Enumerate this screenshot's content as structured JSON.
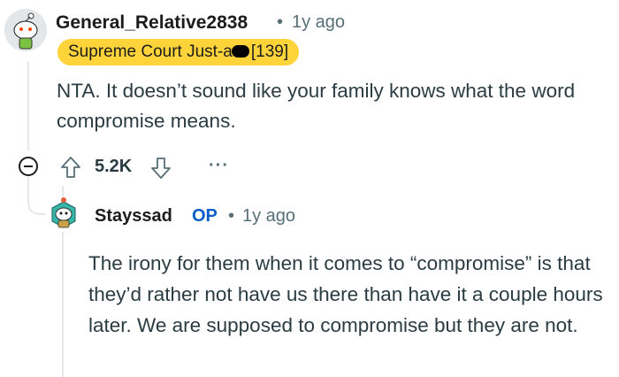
{
  "comment": {
    "username": "General_Relative2838",
    "time": "1y ago",
    "flair_prefix": "Supreme Court Just-a",
    "flair_suffix": "[139]",
    "body": "NTA. It doesn’t sound like your family knows what the word compromise means.",
    "score": "5.2K",
    "more": "···"
  },
  "reply": {
    "username": "Stayssad",
    "op_badge": "OP",
    "time": "1y ago",
    "body": "The irony for them when it comes to “compromise” is that they’d rather not have us there than have it a couple hours later. We are supposed to compromise but they are not."
  },
  "separator": "•",
  "colors": {
    "flair_bg": "#ffd43b",
    "op": "#0a5ec7",
    "meta": "#576f76"
  }
}
